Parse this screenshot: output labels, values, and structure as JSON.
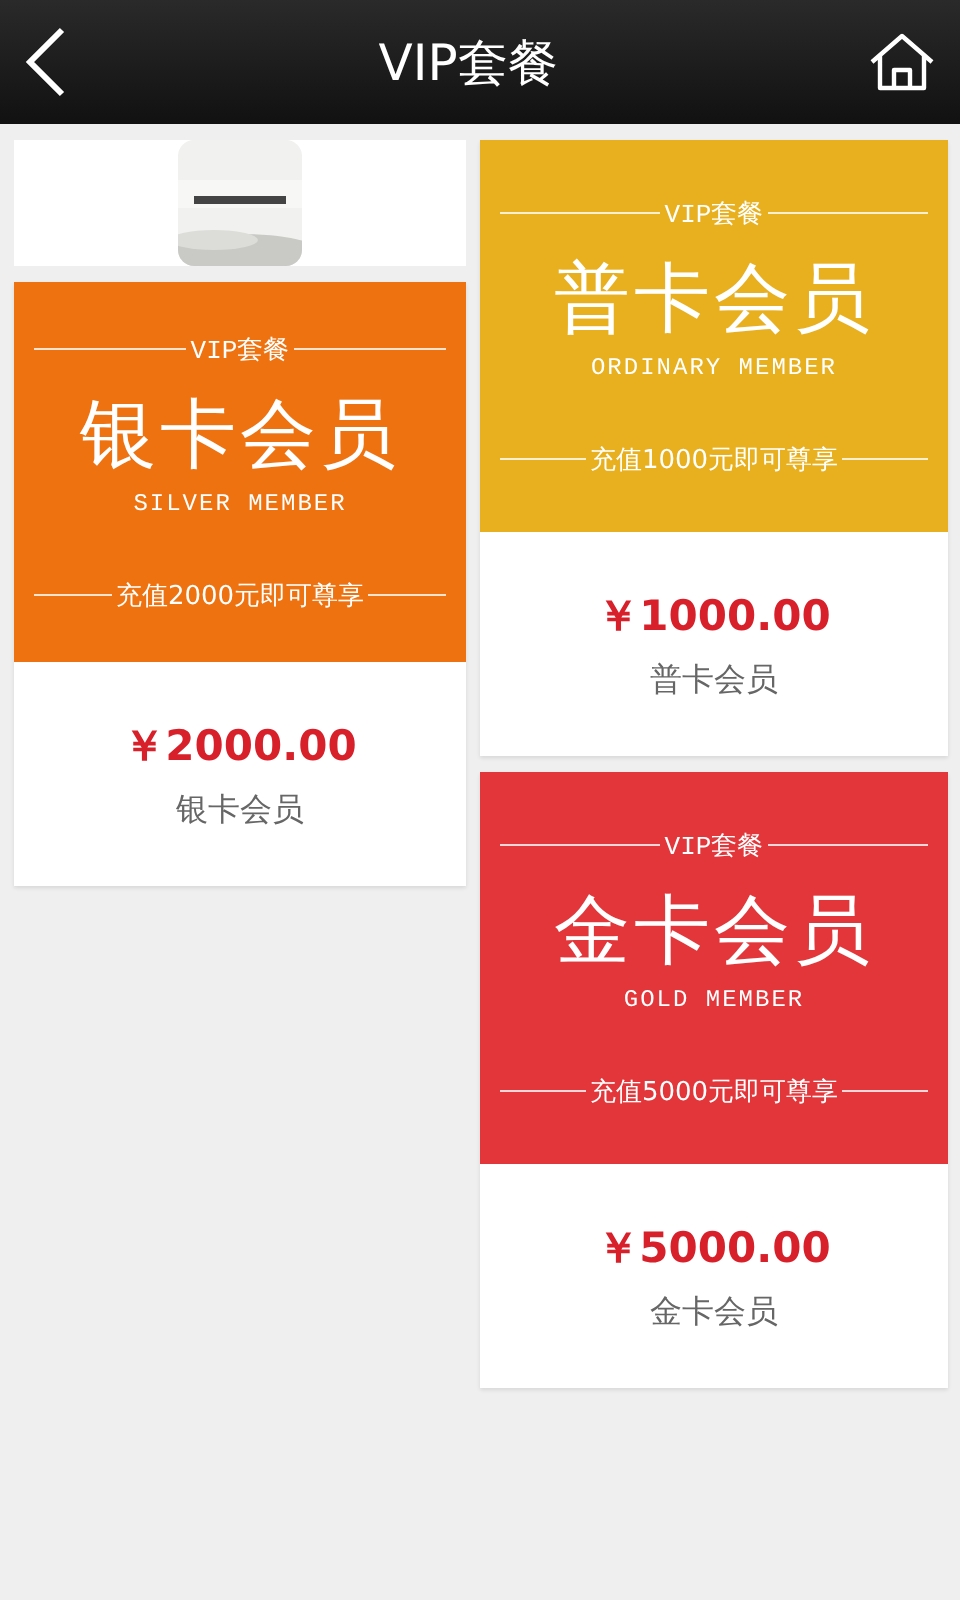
{
  "header": {
    "title": "VIP套餐"
  },
  "columns": [
    [
      {
        "kind": "picture"
      },
      {
        "kind": "plan",
        "color": "#ee720f",
        "tag": "VIP套餐",
        "name": "银卡会员",
        "english": "SILVER MEMBER",
        "offer": "充值2000元即可尊享",
        "price": "￥2000.00",
        "caption": "银卡会员"
      }
    ],
    [
      {
        "kind": "plan",
        "color": "#e8b01f",
        "tag": "VIP套餐",
        "name": "普卡会员",
        "english": "ORDINARY MEMBER",
        "offer": "充值1000元即可尊享",
        "price": "￥1000.00",
        "caption": "普卡会员"
      },
      {
        "kind": "plan",
        "color": "#e2363a",
        "tag": "VIP套餐",
        "name": "金卡会员",
        "english": "GOLD MEMBER",
        "offer": "充值5000元即可尊享",
        "price": "￥5000.00",
        "caption": "金卡会员"
      }
    ]
  ]
}
